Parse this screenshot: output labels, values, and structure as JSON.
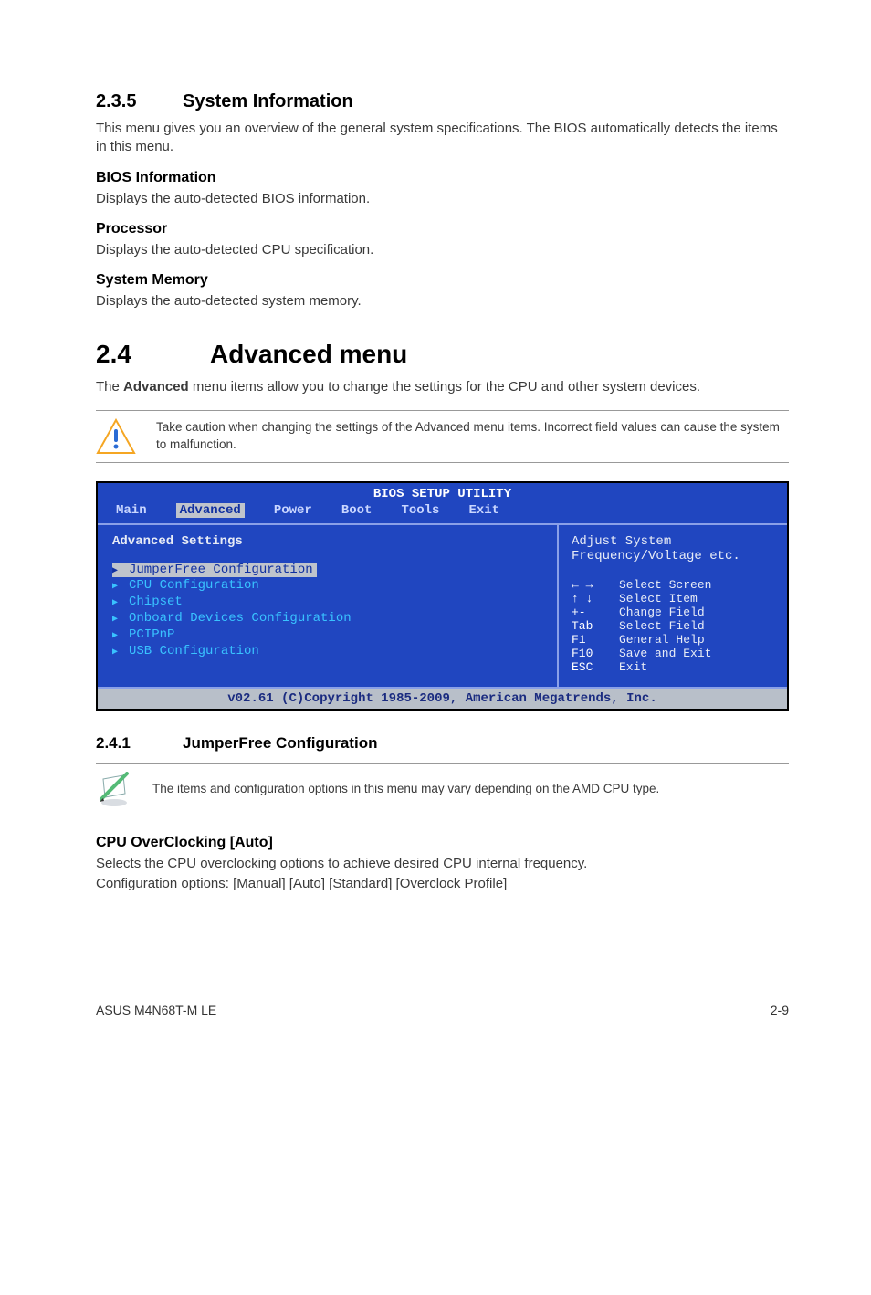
{
  "s235": {
    "num": "2.3.5",
    "title": "System Information",
    "intro": "This menu gives you an overview of the general system specifications. The BIOS automatically detects the items in this menu.",
    "bios": {
      "h": "BIOS Information",
      "p": "Displays the auto-detected BIOS information."
    },
    "proc": {
      "h": "Processor",
      "p": "Displays the auto-detected CPU specification."
    },
    "mem": {
      "h": "System Memory",
      "p": "Displays the auto-detected system memory."
    }
  },
  "s24": {
    "num": "2.4",
    "title": "Advanced menu",
    "intro_pre": "The ",
    "intro_bold": "Advanced",
    "intro_post": " menu items allow you to change the settings for the CPU and other system devices.",
    "warn": "Take caution when changing the settings of the Advanced menu items. Incorrect field values can cause the system to malfunction."
  },
  "bios": {
    "title": "BIOS SETUP UTILITY",
    "tabs": [
      "Main",
      "Advanced",
      "Power",
      "Boot",
      "Tools",
      "Exit"
    ],
    "active_tab": "Advanced",
    "heading": "Advanced Settings",
    "items": [
      "JumperFree Configuration",
      "CPU Configuration",
      "Chipset",
      "Onboard Devices Configuration",
      "PCIPnP",
      "USB Configuration"
    ],
    "selected_index": 0,
    "help_l1": "Adjust System",
    "help_l2": "Frequency/Voltage etc.",
    "keys": [
      {
        "k": "arrows",
        "l": "Select Screen"
      },
      {
        "k": "updn",
        "l": "Select Item"
      },
      {
        "k": "+-",
        "l": "Change Field"
      },
      {
        "k": "Tab",
        "l": "Select Field"
      },
      {
        "k": "F1",
        "l": "General Help"
      },
      {
        "k": "F10",
        "l": "Save and Exit"
      },
      {
        "k": "ESC",
        "l": "Exit"
      }
    ],
    "footer": "v02.61 (C)Copyright 1985-2009, American Megatrends, Inc."
  },
  "s241": {
    "num": "2.4.1",
    "title": "JumperFree Configuration",
    "note": "The items and configuration options in this menu may vary depending on the AMD CPU type.",
    "cpuoc_h": "CPU OverClocking [Auto]",
    "cpuoc_p1": "Selects the CPU overclocking options to achieve desired CPU internal frequency.",
    "cpuoc_p2": "Configuration options: [Manual] [Auto] [Standard] [Overclock Profile]"
  },
  "footer": {
    "left": "ASUS M4N68T-M LE",
    "right": "2-9"
  }
}
